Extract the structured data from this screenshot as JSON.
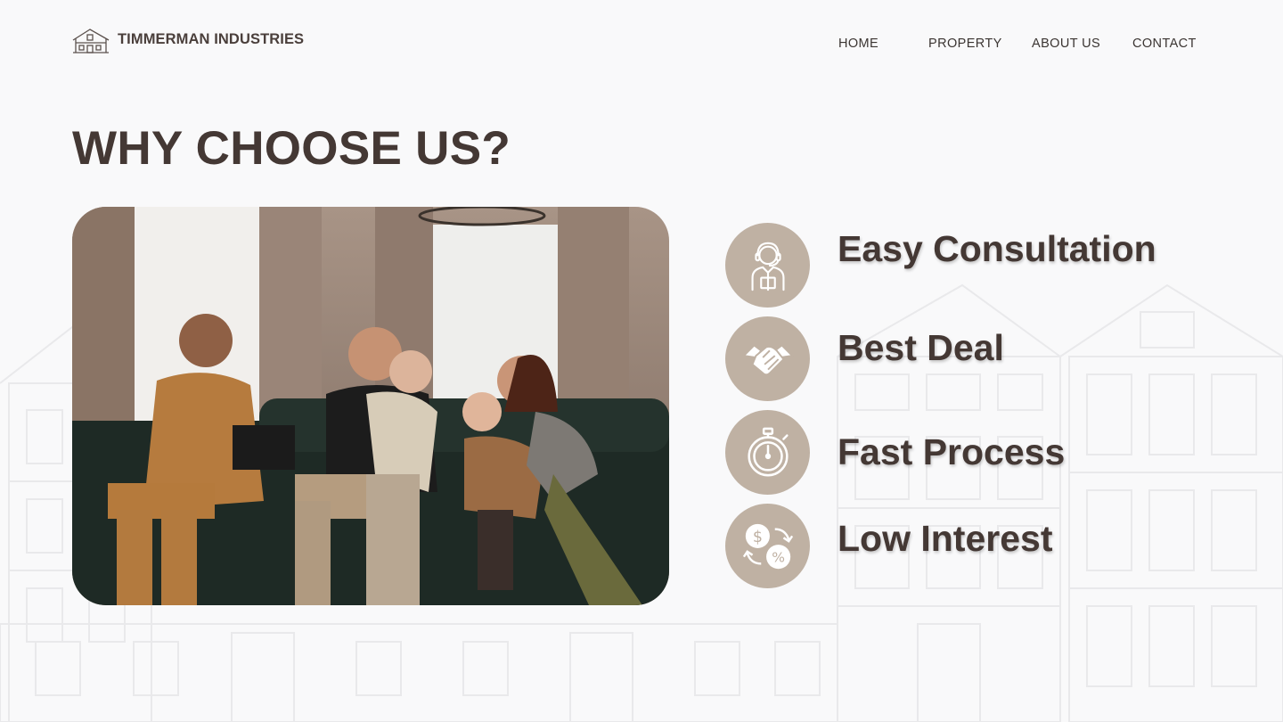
{
  "brand": {
    "name": "TIMMERMAN INDUSTRIES",
    "logo_icon": "house-outline-icon"
  },
  "nav": {
    "items": [
      {
        "label": "HOME"
      },
      {
        "label": "PROPERTY"
      },
      {
        "label": "ABOUT US"
      },
      {
        "label": "CONTACT"
      }
    ]
  },
  "section": {
    "title": "WHY CHOOSE US?"
  },
  "photo": {
    "subject": "family-consultation-photo"
  },
  "features": [
    {
      "label": "Easy Consultation",
      "icon": "consultant-headset-icon"
    },
    {
      "label": "Best Deal",
      "icon": "handshake-icon"
    },
    {
      "label": "Fast Process",
      "icon": "stopwatch-icon"
    },
    {
      "label": "Low Interest",
      "icon": "dollar-percent-exchange-icon"
    }
  ],
  "colors": {
    "background": "#f9f9fa",
    "text": "#443834",
    "icon_circle": "#bfb1a3"
  }
}
